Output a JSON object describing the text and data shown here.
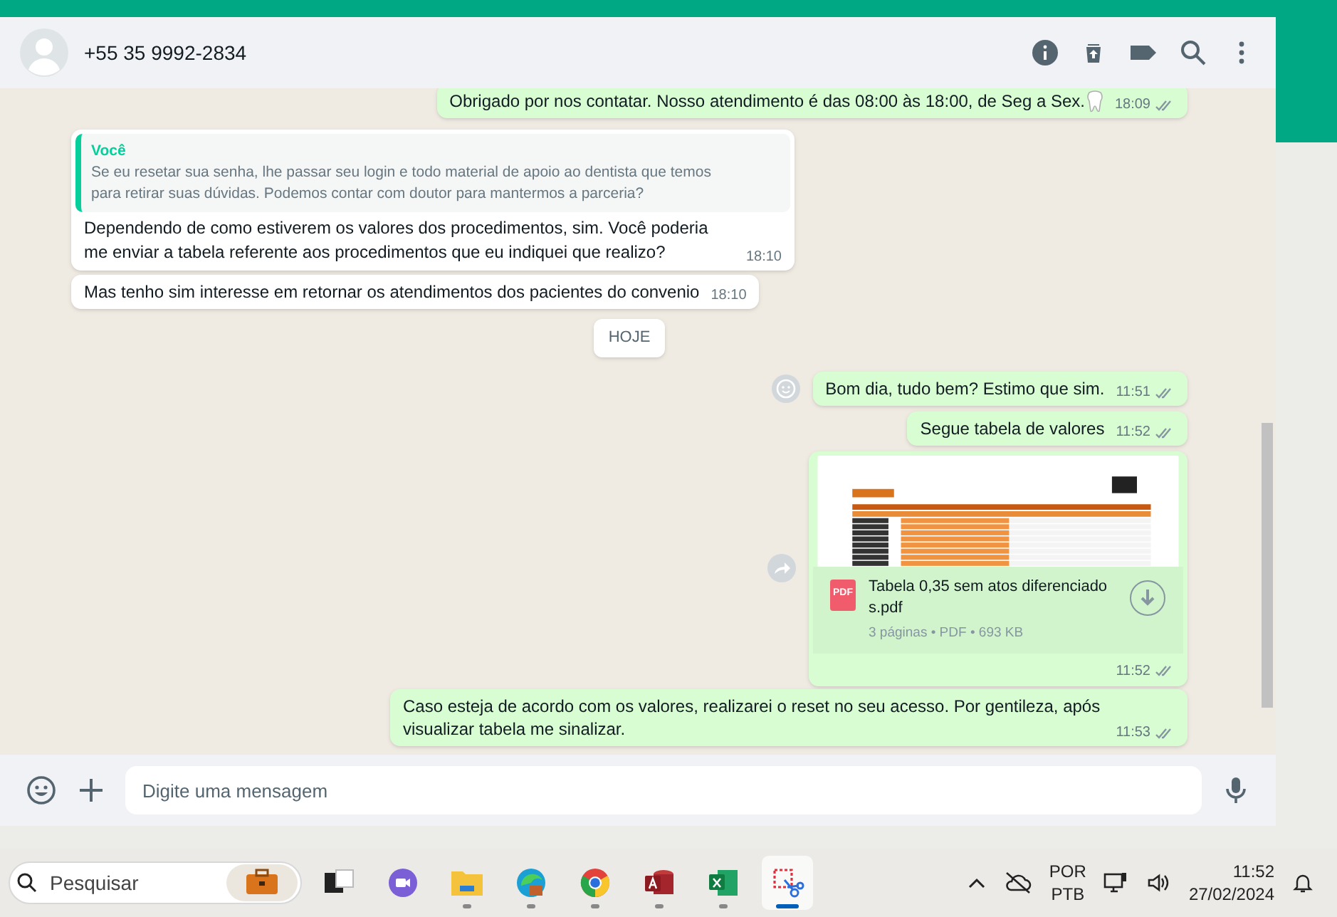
{
  "chat_header": {
    "contact": "+55 35 9992-2834"
  },
  "messages": [
    {
      "kind": "text",
      "outgoing": true,
      "text": "Obrigado por nos contatar. Nosso atendimento é das 08:00 às 18:00, de Seg a Sex.",
      "tooth_emoji": true,
      "time": "18:09",
      "read": true
    },
    {
      "kind": "quoted",
      "outgoing": false,
      "quote_author": "Você",
      "quote_text": "Se eu resetar sua senha, lhe passar seu login e todo material de apoio ao dentista que temos para retirar suas dúvidas. Podemos contar com doutor para mantermos a parceria?",
      "text": "Dependendo de como estiverem os valores dos procedimentos, sim. Você poderia me enviar a tabela referente aos procedimentos que eu indiquei que realizo?",
      "time": "18:10"
    },
    {
      "kind": "text",
      "outgoing": false,
      "text": "Mas tenho sim interesse em retornar os atendimentos dos pacientes do convenio",
      "time": "18:10"
    },
    {
      "kind": "date",
      "text": "HOJE"
    },
    {
      "kind": "text",
      "outgoing": true,
      "text": "Bom dia, tudo bem? Estimo que sim.",
      "time": "11:51",
      "read": true,
      "react_button": true
    },
    {
      "kind": "text",
      "outgoing": true,
      "text": "Segue tabela de valores",
      "time": "11:52",
      "read": true
    },
    {
      "kind": "document",
      "outgoing": true,
      "file_badge": "PDF",
      "file_name": "Tabela 0,35 sem atos diferenciado s.pdf",
      "file_meta": "3 páginas • PDF • 693 KB",
      "time": "11:52",
      "read": true,
      "forward_button": true
    },
    {
      "kind": "text",
      "outgoing": true,
      "text": "Caso esteja de acordo com os valores, realizarei o reset no seu acesso. Por gentileza, após visualizar tabela me sinalizar.",
      "time": "11:53",
      "read": true
    }
  ],
  "composer": {
    "placeholder": "Digite uma mensagem"
  },
  "taskbar": {
    "search_placeholder": "Pesquisar",
    "apps": [
      {
        "kind": "multitask",
        "running": false,
        "selected": false
      },
      {
        "kind": "meet",
        "running": false,
        "selected": false
      },
      {
        "kind": "folder",
        "running": true,
        "selected": false
      },
      {
        "kind": "edge",
        "running": true,
        "selected": false
      },
      {
        "kind": "chrome",
        "running": true,
        "selected": false
      },
      {
        "kind": "access",
        "running": true,
        "selected": false
      },
      {
        "kind": "excel",
        "running": true,
        "selected": false
      },
      {
        "kind": "snip",
        "running": true,
        "selected": true
      }
    ],
    "language": "POR",
    "layout": "PTB",
    "time": "11:52",
    "date": "27/02/2024"
  }
}
